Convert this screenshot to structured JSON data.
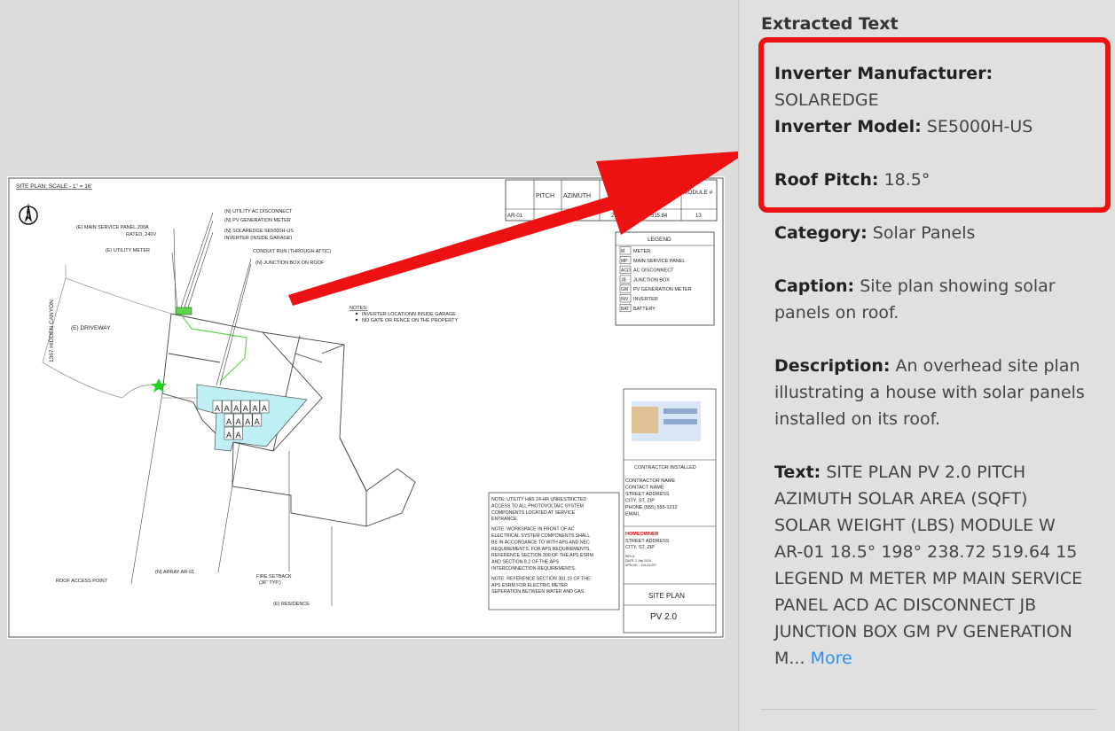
{
  "panel": {
    "heading": "Extracted Text",
    "fields": [
      {
        "key": "Inverter Manufacturer:",
        "value": "SOLAREDGE"
      },
      {
        "key": "Inverter Model:",
        "value": "SE5000H-US"
      },
      {
        "key": "Roof Pitch:",
        "value": "18.5°"
      },
      {
        "key": "Category:",
        "value": "Solar Panels"
      },
      {
        "key": "Caption:",
        "value": "Site plan showing solar panels on roof."
      },
      {
        "key": "Description:",
        "value": "An overhead site plan illustrating a house with solar panels installed on its roof."
      },
      {
        "key": "Text:",
        "value": "SITE PLAN PV 2.0 PITCH AZIMUTH SOLAR AREA (SQFT) SOLAR WEIGHT (LBS) MODULE W AR-01 18.5° 198° 238.72 519.64 15 LEGEND M METER MP MAIN SERVICE PANEL ACD AC DISCONNECT JB JUNCTION BOX GM PV GENERATION M..."
      }
    ],
    "more_label": "More",
    "highlight_color": "#ee1111",
    "link_color": "#2e8fe6"
  },
  "plan": {
    "title": "SITE PLAN: SCALE:- 1\" = 16'",
    "table": {
      "headers": [
        "PITCH",
        "AZIMUTH",
        "SOLAR AREA (SQFT)",
        "SOLAR WEIGHT",
        "MODULE #"
      ],
      "row": [
        "AR-01",
        "",
        "198°",
        "239.72",
        "515.84",
        "13"
      ]
    },
    "legend_title": "LEGEND",
    "legend": [
      {
        "sym": "M",
        "label": "METER"
      },
      {
        "sym": "MP",
        "label": "MAIN SERVICE PANEL"
      },
      {
        "sym": "ACD",
        "label": "AC DISCONNECT"
      },
      {
        "sym": "JB",
        "label": "JUNCTION BOX"
      },
      {
        "sym": "GM",
        "label": "PV GENERATION METER"
      },
      {
        "sym": "INV",
        "label": "INVERTER"
      },
      {
        "sym": "BAT",
        "label": "BATTERY"
      }
    ],
    "callouts": {
      "utility_ac_disconnect": "(N) UTILITY AC DISCONNECT",
      "pv_generation_meter": "(N)  PV GENERATION METER",
      "inverter_1": "(N) SOLAREDGE SE5000H-US",
      "inverter_2": "INVERTER (INSIDE GARAGE)",
      "main_panel_1": "(E) MAIN SERVICE PANEL,200A",
      "main_panel_2": "RATED, 240V",
      "utility_meter": "(E) UTILITY METER",
      "conduit_run": "CONDUIT RUN (THROUGH ATTIC)",
      "junction_box": "(N) JUNCTION BOX ON ROOF",
      "street": "1367 HIDDEN CANYON",
      "driveway": "(E)  DRIVEWAY",
      "roof_access": "ROOF ACCESS POINT",
      "array": "(N) ARRAY AR-01",
      "fire_setback_1": "FIRE SETBACK",
      "fire_setback_2": "(36\" TYP.)",
      "residence": "(E) RESIDENCE"
    },
    "notes_title": "NOTES:",
    "notes": [
      "INVERTER LOCATIONN INSIDE GARAGE",
      "NO GATE OR FENCE ON THE PROPERTY"
    ],
    "note_block": [
      "NOTE: UTILITY HAS 24-HR UNRESTRICTED",
      "ACCESS TO ALL PHOTOVOLTAIC SYSTEM",
      "COMPONENTS LOCATED AT SERVICE",
      "ENTRANCE.",
      "NOTE: WORKSPACE IN FRONT OF AC",
      "ELECTRICAL SYSTEM COMPONENTS SHALL",
      "BE IN ACCORDANCE TO WITH APS AND NEC",
      "REQUIREMENTS. FOR APS REQUIREMENTS,",
      "REFERENCE SECTION 300 OF THE APS ESRM",
      "AND SECTION 8.2 OF THE APS",
      "INTERCONNECTION REQUIREMENTS.",
      "NOTE: REFERENCE SECTION 301.15 OF THE",
      "APS ESRM FOR ELECTRIC METER",
      "SEPERATION BETWEEN WATER AND GAS."
    ],
    "contractor_title": "CONTRACTOR INSTALLED",
    "contractor": [
      "CONTRACTOR NAME",
      "CONTACT NAME",
      "STREET ADDRESS",
      "CITY, ST, ZIP",
      "PHONE (555) 555-1212",
      "EMAIL"
    ],
    "homeowner_title": "HOMEOWNER",
    "homeowner": [
      "STREET ADDRESS",
      "CITY, ST, ZIP"
    ],
    "rev": [
      "REV A",
      "DATE: 2 July 2019",
      "APN NO. : 115-23-007"
    ],
    "sheet_name": "SITE PLAN",
    "sheet_number": "PV 2.0",
    "module_label": "A",
    "north_label": "N"
  }
}
